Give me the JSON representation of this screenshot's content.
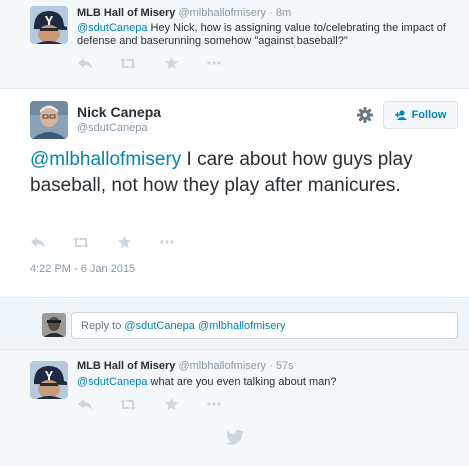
{
  "tweets_above": [
    {
      "fullname": "MLB Hall of Misery",
      "handle": "@mlbhallofmisery",
      "time": "· 8m",
      "mention": "@sdutCanepa",
      "text": " Hey Nick, how is assigning value to/celebrating the impact of defense and baserunning somehow \"against baseball?\""
    }
  ],
  "main_tweet": {
    "fullname": "Nick Canepa",
    "handle": "@sdutCanepa",
    "follow_label": "Follow",
    "mention": "@mlbhallofmisery",
    "text": " I care about how guys play baseball, not how they play after manicures.",
    "timestamp": "4:22 PM - 6 Jan 2015"
  },
  "reply_box": {
    "prefix": "Reply to ",
    "mentions": "@sdutCanepa @mlbhallofmisery"
  },
  "tweets_below": [
    {
      "fullname": "MLB Hall of Misery",
      "handle": "@mlbhallofmisery",
      "time": "· 57s",
      "mention": "@sdutCanepa",
      "text": " what are you even talking about man?"
    }
  ],
  "colors": {
    "link": "#0084b4",
    "text": "#292f33",
    "muted": "#8899a6",
    "icon": "#ccd6dd",
    "background": "#f5f8fa"
  },
  "icons": [
    "reply-icon",
    "retweet-icon",
    "favorite-icon",
    "more-icon",
    "gear-icon",
    "follow-icon",
    "twitter-bird-icon"
  ]
}
